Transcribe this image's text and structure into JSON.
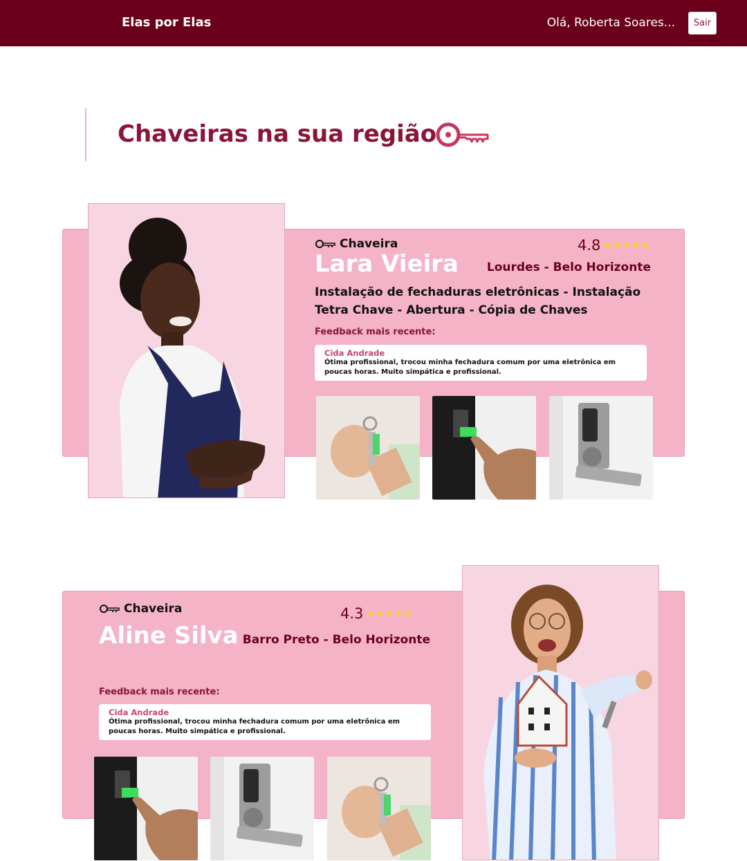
{
  "header": {
    "brand": "Elas por Elas",
    "greeting": "Olá,  Roberta Soares...",
    "logout_label": "Sair"
  },
  "section": {
    "title": "Chaveiras na sua região"
  },
  "colors": {
    "topbar": "#6b001c",
    "accent": "#8a1538",
    "panel": "#f4b3c6",
    "photo_bg": "#f7d6e2",
    "star": "#f7d51a"
  },
  "professionals": [
    {
      "role": "Chaveira",
      "name": "Lara Vieira",
      "rating": "4.8",
      "stars": 5,
      "location": "Lourdes - Belo Horizonte",
      "services": "Instalação de fechaduras eletrônicas - Instalação Tetra Chave - Abertura - Cópia de Chaves",
      "feedback_label": "Feedback mais recente:",
      "feedback": {
        "author": "Cida Andrade",
        "text": "Ótima profissional, trocou minha fechadura comum por uma eletrônica em poucas horas. Muito simpática e profissional."
      },
      "gallery": [
        "key-in-hand",
        "fingerprint-lock",
        "electronic-door-lock"
      ]
    },
    {
      "role": "Chaveira",
      "name": "Aline Silva",
      "rating": "4.3",
      "stars": 5,
      "location": "Barro Preto - Belo Horizonte",
      "feedback_label": "Feedback mais recente:",
      "feedback": {
        "author": "Cida Andrade",
        "text": "Ótima profissional, trocou minha fechadura comum por uma eletrônica em poucas horas. Muito simpática e profissional."
      },
      "gallery": [
        "fingerprint-lock",
        "electronic-door-lock",
        "key-in-hand"
      ]
    }
  ]
}
